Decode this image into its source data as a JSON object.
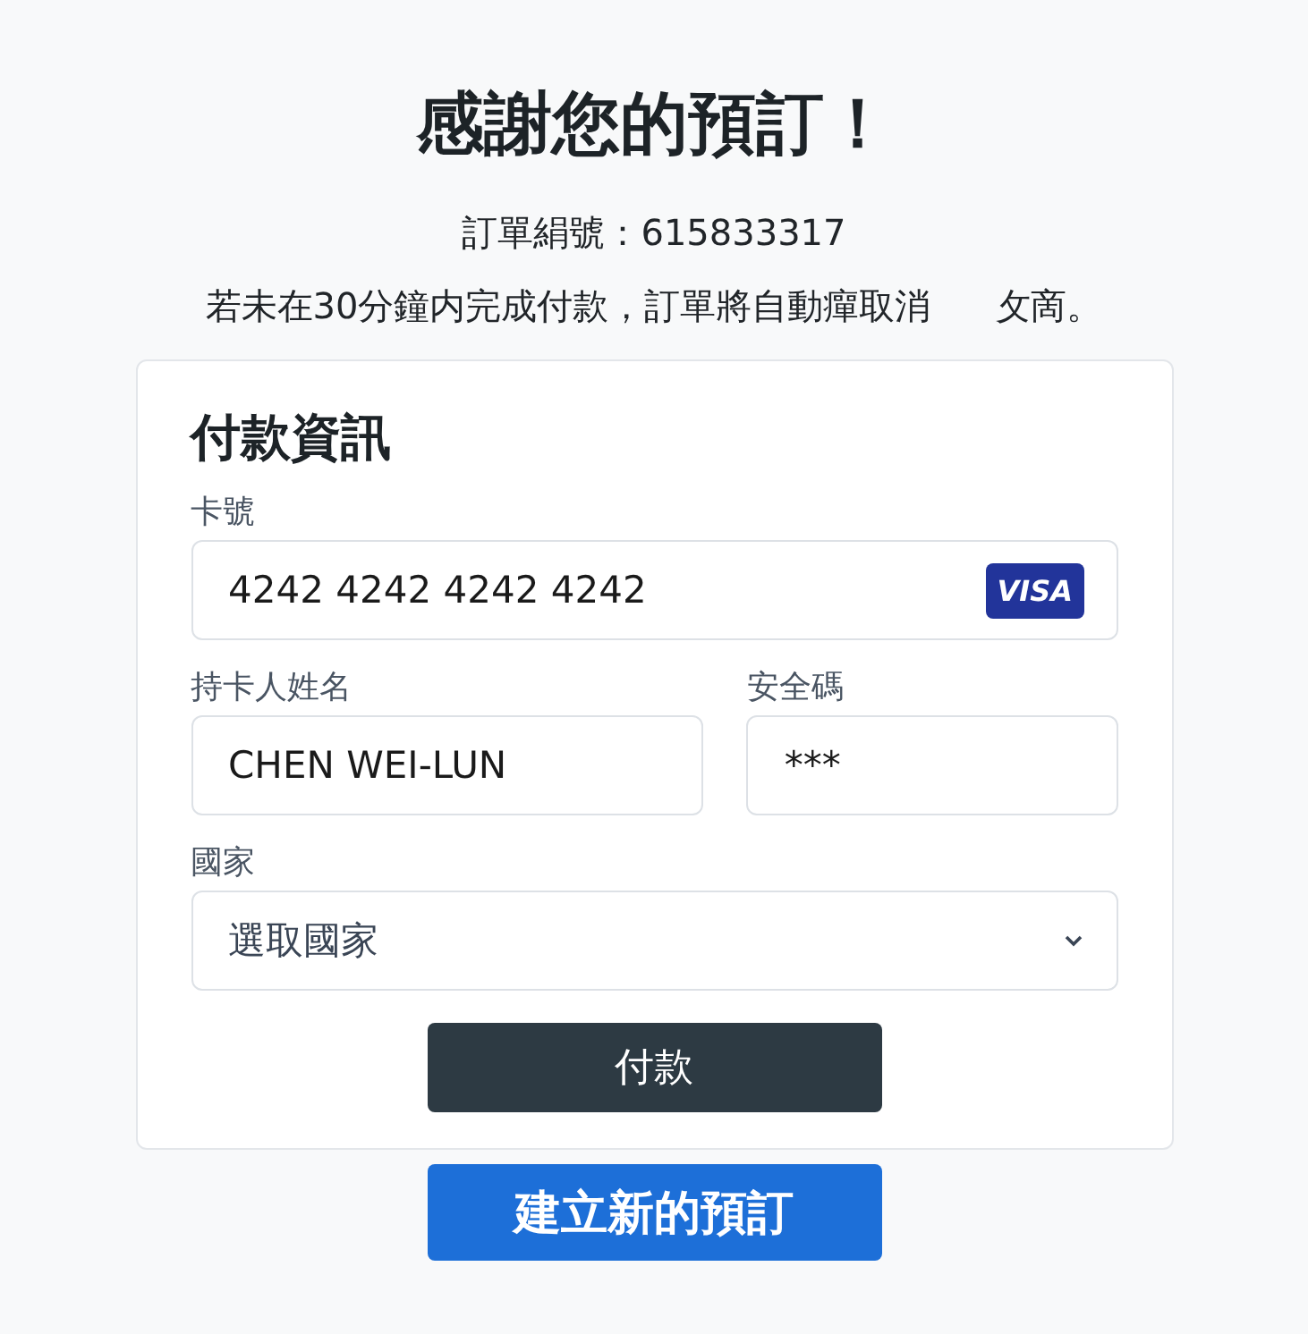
{
  "title": "感謝您的預訂！",
  "order_number": "訂單絹號：615833317",
  "notice": [
    "若未在30分鐘内完成付款，訂單將自動癉取消",
    "攵啇。"
  ],
  "payment": {
    "heading": "付款資訊",
    "card_number": {
      "label": "卡號",
      "value": "4242 4242 4242 4242",
      "brand": "VISA"
    },
    "cardholder": {
      "label": "持卡人姓名",
      "value": "CHEN WEI-LUN"
    },
    "cvc": {
      "label": "安全碼",
      "value": "***"
    },
    "country": {
      "label": "國家",
      "placeholder": "選取國家"
    },
    "submit": "付款"
  },
  "new_booking": "建立新的預訂"
}
